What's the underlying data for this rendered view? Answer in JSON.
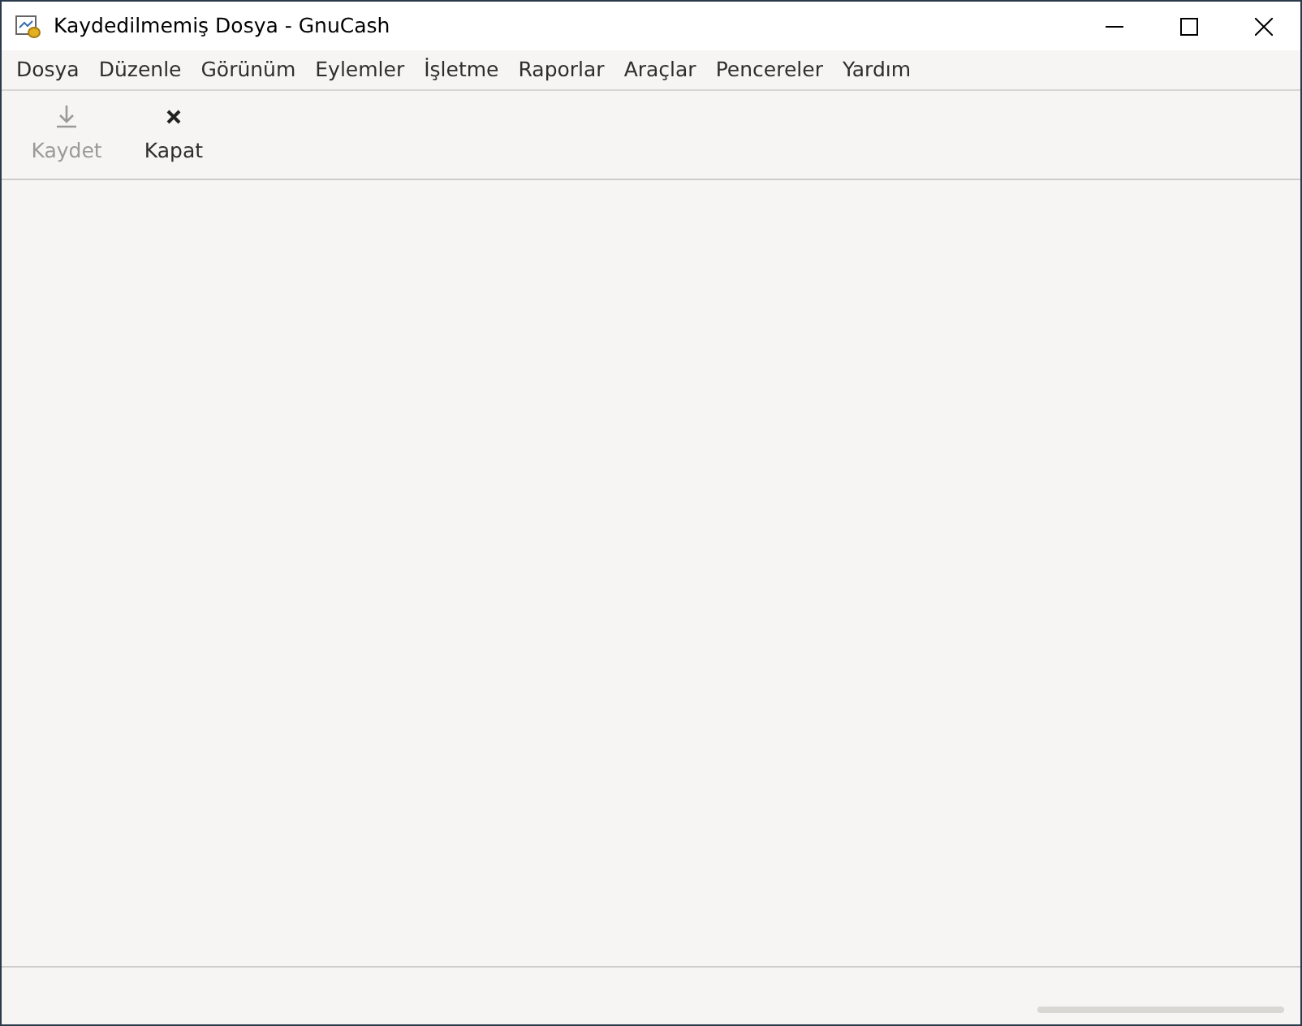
{
  "window": {
    "title": "Kaydedilmemiş Dosya - GnuCash"
  },
  "menu": [
    "Dosya",
    "Düzenle",
    "Görünüm",
    "Eylemler",
    "İşletme",
    "Raporlar",
    "Araçlar",
    "Pencereler",
    "Yardım"
  ],
  "toolbar": [
    {
      "label": "Kaydet",
      "kind": "save",
      "disabled": true
    },
    {
      "label": "Kapat",
      "kind": "close",
      "disabled": false
    }
  ],
  "status_bar": {
    "progress": {
      "level": 0
    }
  }
}
